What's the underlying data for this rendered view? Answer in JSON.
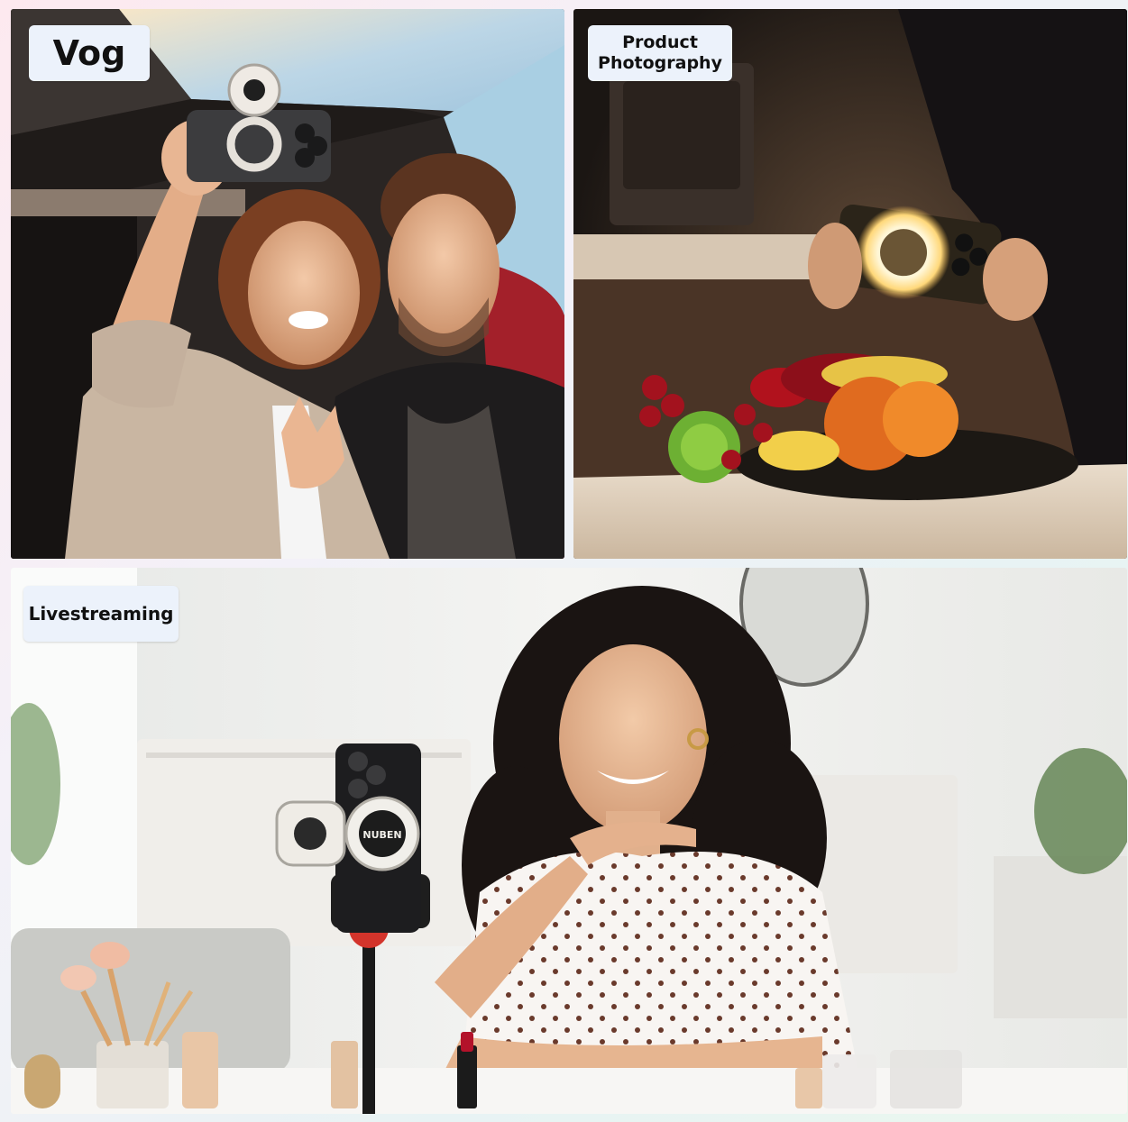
{
  "panels": {
    "vlog": {
      "label": "Vog"
    },
    "product": {
      "label": "Product\nPhotography"
    },
    "live": {
      "label": "Livestreaming",
      "phone_holder_brand": "NUBEN"
    }
  },
  "colors": {
    "page_background": "#f3f1f7",
    "label_background": "#ecf2fb",
    "label_text": "#111111"
  }
}
